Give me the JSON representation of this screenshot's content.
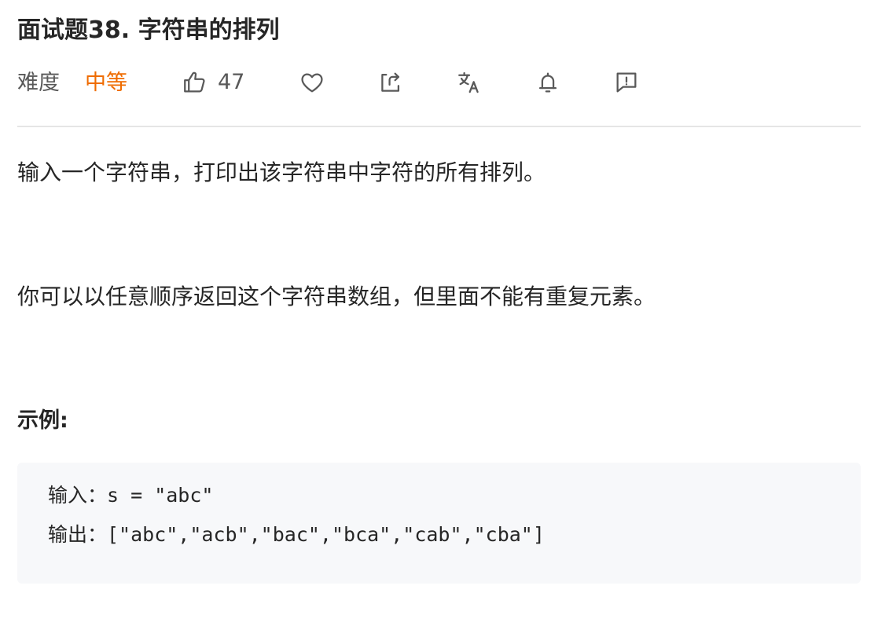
{
  "problem": {
    "title": "面试题38. 字符串的排列",
    "difficulty_label": "难度",
    "difficulty_value": "中等",
    "difficulty_color": "#ef6c00",
    "like_count": "47"
  },
  "toolbar": {
    "icons": [
      "thumbs-up-icon",
      "heart-icon",
      "share-icon",
      "translate-icon",
      "bell-icon",
      "feedback-icon"
    ]
  },
  "description": {
    "paragraph_1": "输入一个字符串，打印出该字符串中字符的所有排列。",
    "paragraph_2": "你可以以任意顺序返回这个字符串数组，但里面不能有重复元素。"
  },
  "example": {
    "heading": "示例:",
    "input_line": "输入：s = \"abc\"",
    "output_line": "输出：[\"abc\",\"acb\",\"bac\",\"bca\",\"cab\",\"cba\"]"
  }
}
